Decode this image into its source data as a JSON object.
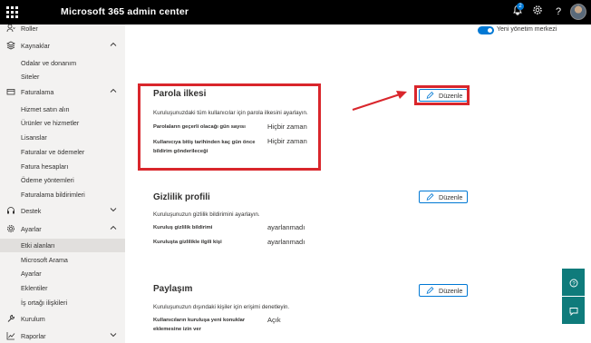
{
  "header": {
    "app_title": "Microsoft 365 admin center",
    "notification_count": "2"
  },
  "sidebar": {
    "items": [
      {
        "label": "Roller",
        "icon": "roles-icon",
        "kind": "top"
      },
      {
        "label": "Kaynaklar",
        "icon": "resources-icon",
        "kind": "top",
        "expanded": true
      },
      {
        "label": "Odalar ve donanım",
        "kind": "sub"
      },
      {
        "label": "Siteler",
        "kind": "sub"
      },
      {
        "label": "Faturalama",
        "icon": "billing-icon",
        "kind": "top",
        "expanded": true
      },
      {
        "label": "Hizmet satın alın",
        "kind": "sub"
      },
      {
        "label": "Ürünler ve hizmetler",
        "kind": "sub"
      },
      {
        "label": "Lisanslar",
        "kind": "sub"
      },
      {
        "label": "Faturalar ve ödemeler",
        "kind": "sub"
      },
      {
        "label": "Fatura hesapları",
        "kind": "sub"
      },
      {
        "label": "Ödeme yöntemleri",
        "kind": "sub"
      },
      {
        "label": "Faturalama bildirimleri",
        "kind": "sub"
      },
      {
        "label": "Destek",
        "icon": "support-icon",
        "kind": "top",
        "expanded": false
      },
      {
        "label": "Ayarlar",
        "icon": "settings-icon",
        "kind": "top",
        "expanded": true
      },
      {
        "label": "Etki alanları",
        "kind": "sub",
        "active": true
      },
      {
        "label": "Microsoft Arama",
        "kind": "sub"
      },
      {
        "label": "Ayarlar",
        "kind": "sub"
      },
      {
        "label": "Eklentiler",
        "kind": "sub"
      },
      {
        "label": "İş ortağı ilişkileri",
        "kind": "sub"
      },
      {
        "label": "Kurulum",
        "icon": "setup-icon",
        "kind": "top"
      },
      {
        "label": "Raporlar",
        "icon": "reports-icon",
        "kind": "top",
        "expanded": false
      }
    ]
  },
  "main": {
    "new_admin_center_label": "Yeni yönetim merkezi",
    "edit_label": "Düzenle",
    "sections": {
      "password": {
        "title": "Parola ilkesi",
        "description": "Kuruluşunuzdaki tüm kullanıcılar için parola ilkesini ayarlayın.",
        "settings": [
          {
            "label": "Parolaların geçerli olacağı gün sayısı",
            "value": "Hiçbir zaman"
          },
          {
            "label": "Kullanıcıya bitiş tarihinden kaç gün önce bildirim gönderileceği",
            "value": "Hiçbir zaman"
          }
        ]
      },
      "privacy": {
        "title": "Gizlilik profili",
        "description": "Kuruluşunuzun gizlilik bildirimini ayarlayın.",
        "settings": [
          {
            "label": "Kuruluş gizlilik bildirimi",
            "value": "ayarlanmadı"
          },
          {
            "label": "Kuruluşta gizlilikle ilgili kişi",
            "value": "ayarlanmadı"
          }
        ]
      },
      "sharing": {
        "title": "Paylaşım",
        "description": "Kuruluşunuzun dışındaki kişiler için erişimi denetleyin.",
        "settings": [
          {
            "label": "Kullanıcıların kuruluşa yeni konuklar eklemesine izin ver",
            "value": "Açık"
          }
        ]
      }
    }
  },
  "annotation_color": "#d9262c",
  "accent_color": "#0078d4"
}
